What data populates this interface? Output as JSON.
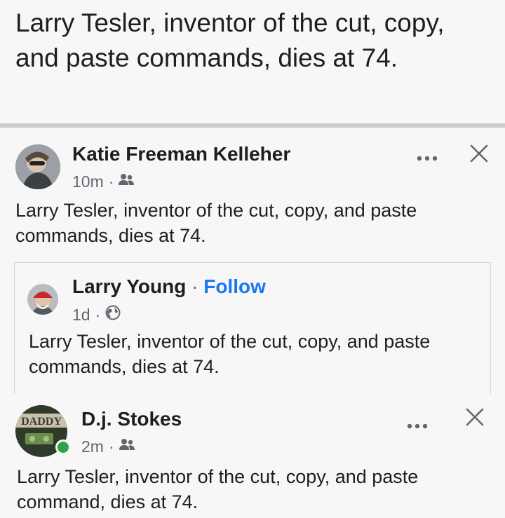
{
  "headline": {
    "text": "Larry Tesler, inventor of the cut, copy, and paste commands, dies at 74."
  },
  "post1": {
    "author": "Katie Freeman Kelleher",
    "time": "10m",
    "audience_icon": "friends-icon",
    "body": "Larry Tesler, inventor of the cut, copy, and paste commands, dies at 74.",
    "shared": {
      "author": "Larry Young",
      "separator": "·",
      "follow_label": "Follow",
      "time": "1d",
      "audience_icon": "globe-icon",
      "body": "Larry Tesler, inventor of the cut, copy, and paste commands, dies at 74."
    }
  },
  "post2": {
    "author": "D.j. Stokes",
    "avatar_text": "DADDY",
    "time": "2m",
    "audience_icon": "friends-icon",
    "body": "Larry Tesler, inventor of the cut, copy, and paste command, dies at 74."
  },
  "colors": {
    "link": "#1877f2",
    "online": "#31a24c"
  }
}
